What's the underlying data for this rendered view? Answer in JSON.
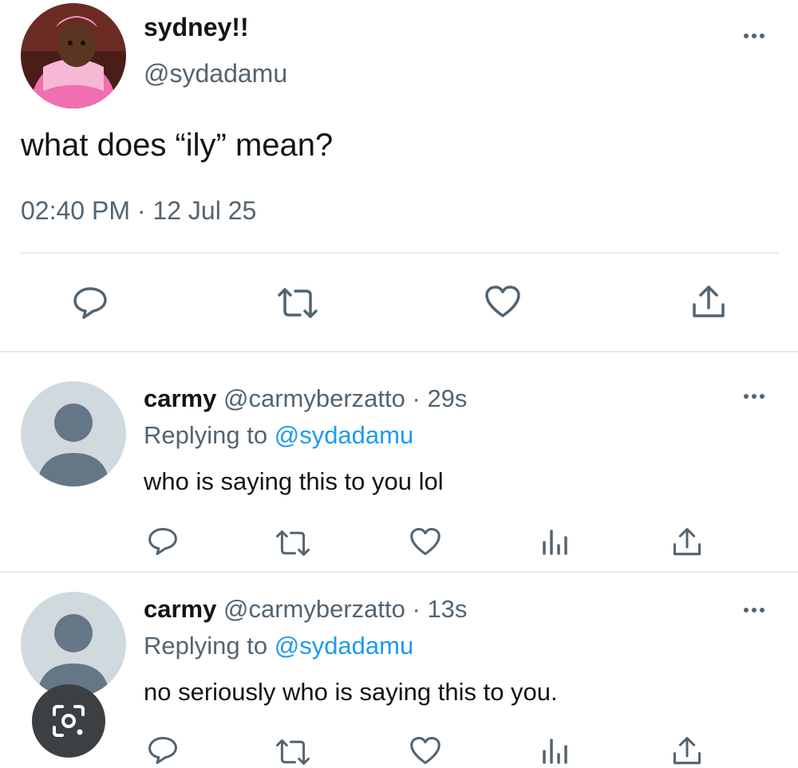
{
  "main_tweet": {
    "display_name": "sydney!!",
    "handle": "@sydadamu",
    "text": "what does “ily” mean?",
    "time": "02:40 PM",
    "separator": "·",
    "date": "12 Jul 25"
  },
  "replies": [
    {
      "display_name": "carmy",
      "handle": "@carmyberzatto",
      "separator": "·",
      "age": "29s",
      "replying_prefix": "Replying to",
      "replying_to": "@sydadamu",
      "text": "who is saying this to you lol"
    },
    {
      "display_name": "carmy",
      "handle": "@carmyberzatto",
      "separator": "·",
      "age": "13s",
      "replying_prefix": "Replying to",
      "replying_to": "@sydadamu",
      "text": "no seriously who is saying this to you."
    }
  ],
  "icons": [
    "reply-icon",
    "retweet-icon",
    "like-icon",
    "share-icon",
    "analytics-icon",
    "more-icon",
    "google-lens-icon"
  ],
  "colors": {
    "link": "#1d9bf0",
    "muted": "#536471",
    "divider": "#e8eaec",
    "lens_button": "#3c4043"
  }
}
